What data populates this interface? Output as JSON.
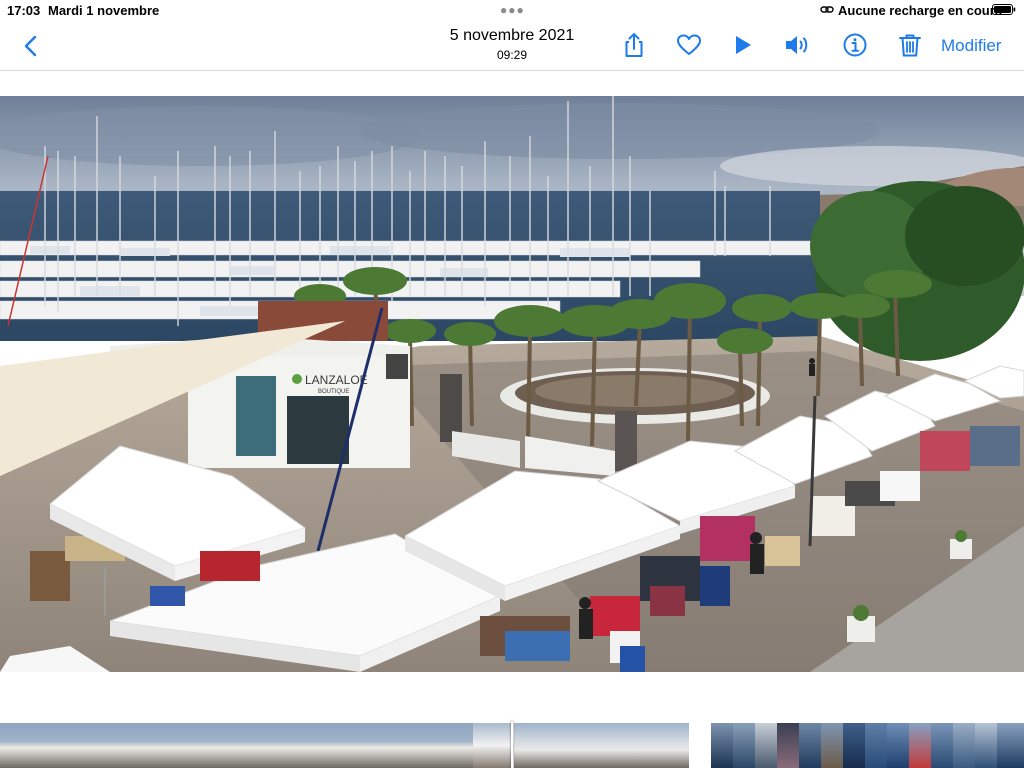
{
  "status_bar": {
    "time": "17:03",
    "date": "Mardi 1 novembre",
    "battery_text": "Aucune recharge en cours"
  },
  "toolbar": {
    "photo_date": "5 novembre 2021",
    "photo_time": "09:29",
    "edit_label": "Modifier",
    "accent_color": "#1e7bea"
  },
  "photo": {
    "signage": "LANZALOE",
    "signage_sub": "BOUTIQUE"
  },
  "icons": [
    "back-chevron-icon",
    "share-icon",
    "heart-icon",
    "play-icon",
    "speaker-icon",
    "info-icon",
    "trash-icon",
    "link-icon",
    "battery-icon"
  ]
}
